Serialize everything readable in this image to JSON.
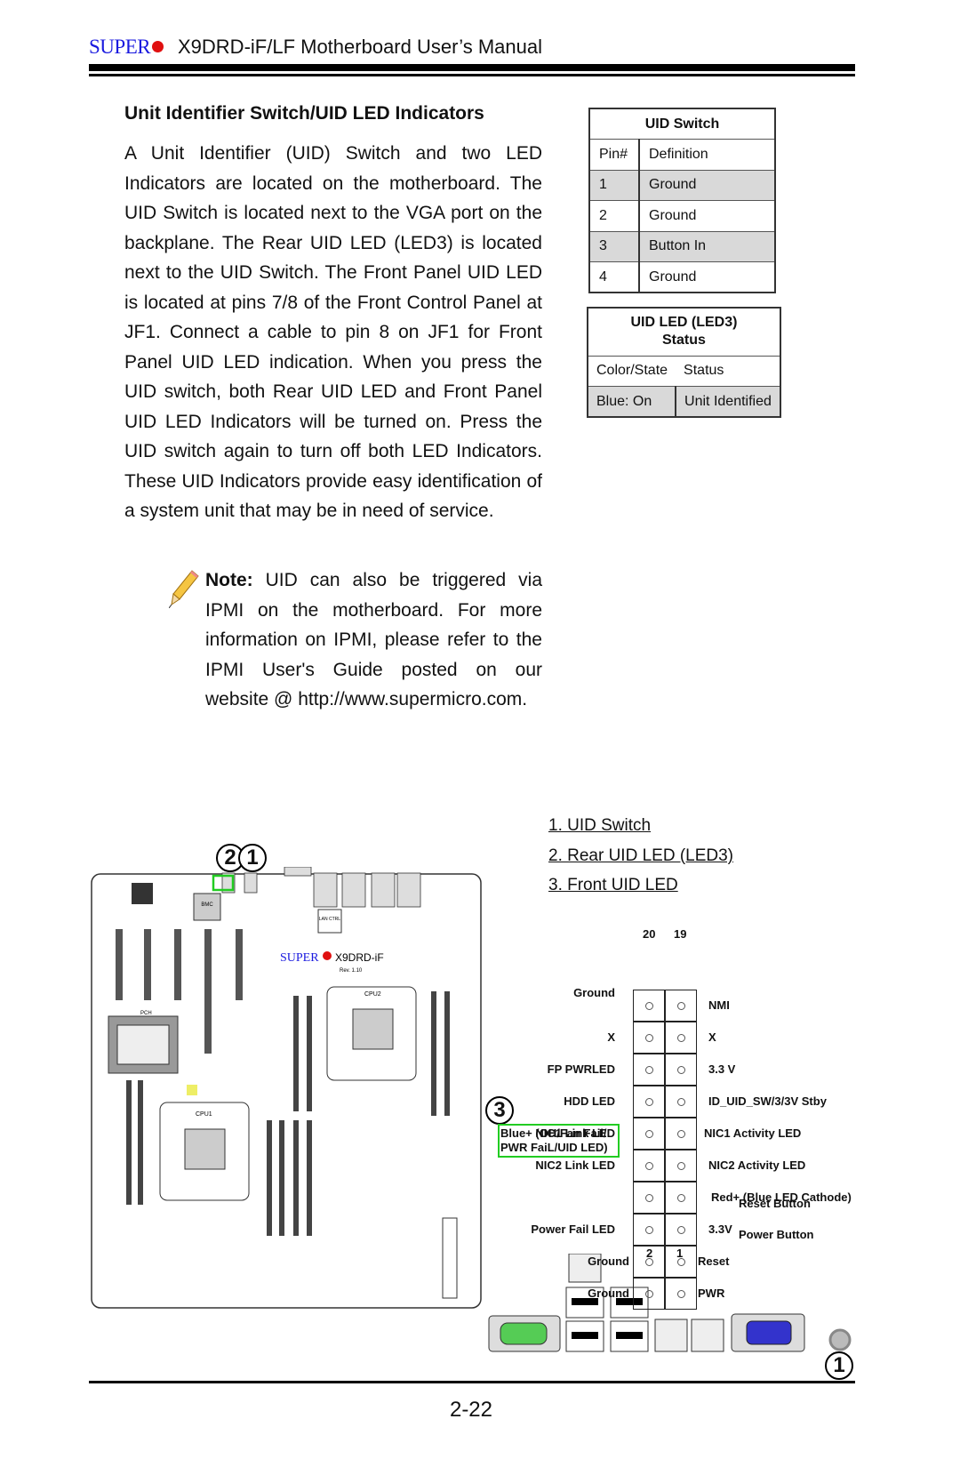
{
  "header": {
    "logo_text": "SUPER",
    "title": "X9DRD-iF/LF Motherboard User’s Manual"
  },
  "section": {
    "heading": "Unit Identifier Switch/UID LED Indicators",
    "body": "A Unit Identifier (UID) Switch and two LED Indicators are located on the motherboard. The UID Switch is located next to the VGA port on the backplane. The Rear UID LED (LED3) is located next to the UID Switch. The Front Panel UID LED is located at pins 7/8 of the Front Control Panel at JF1. Connect a cable to pin 8 on JF1 for Front Panel UID LED indication. When you press the UID switch, both Rear UID LED and Front Panel UID LED Indicators will be turned on. Press the UID switch again to turn off both LED Indicators. These UID Indicators provide easy identification of a system unit that may be in need of service.",
    "note_label": "Note:",
    "note_text": " UID can also be triggered via IPMI on the motherboard. For more information on IPMI, please refer to the IPMI User's Guide posted on our website @ http://www.supermicro.com."
  },
  "uid_switch_table": {
    "title": "UID Switch",
    "headers": [
      "Pin#",
      "Definition"
    ],
    "rows": [
      [
        "1",
        "Ground"
      ],
      [
        "2",
        "Ground"
      ],
      [
        "3",
        "Button In"
      ],
      [
        "4",
        "Ground"
      ]
    ]
  },
  "uid_led_table": {
    "title_line1": "UID LED (LED3)",
    "title_line2": "Status",
    "headers": [
      "Color/State",
      "Status"
    ],
    "rows": [
      [
        "Blue: On",
        "Unit Identified"
      ]
    ]
  },
  "legend": [
    "1. UID Switch",
    "2. Rear UID LED (LED3)",
    "3. Front UID LED"
  ],
  "board": {
    "logo": "SUPER",
    "model": "X9DRD-iF",
    "rev": "Rev. 1.10",
    "cpu1": "CPU1",
    "cpu2": "CPU2",
    "pch": "PCH",
    "bmc": "BMC",
    "lan": "LAN CTRL"
  },
  "callouts": [
    "1",
    "2",
    "3"
  ],
  "pin_header": {
    "top_numbers": [
      "20",
      "19"
    ],
    "bottom_numbers": [
      "2",
      "1"
    ],
    "left_labels": [
      "Ground",
      "X",
      "FP PWRLED",
      "HDD LED",
      "NIC1 Link LED",
      "NIC2 Link LED",
      "Blue+ (OH/Fan Fail/ PWR FaiL/UID LED)",
      "Power Fail LED",
      "Ground",
      "Ground"
    ],
    "right_labels": [
      "NMI",
      "X",
      "3.3 V",
      "ID_UID_SW/3/3V Stby",
      "NIC1 Activity LED",
      "NIC2 Activity LED",
      "Red+ (Blue LED Cathode)",
      "3.3V",
      "Reset",
      "PWR"
    ],
    "button_labels": [
      "Reset Button",
      "Power Button"
    ],
    "highlight_color": "#22cc22"
  },
  "footer": {
    "page": "2-22"
  }
}
